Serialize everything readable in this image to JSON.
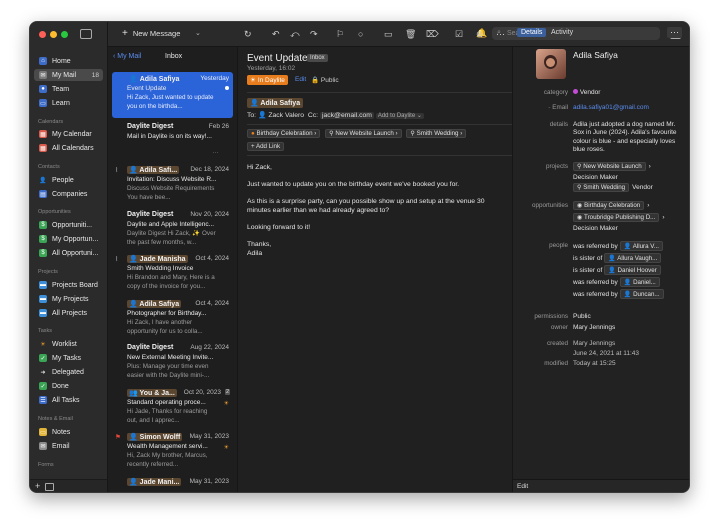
{
  "toolbar": {
    "new_message": "New Message",
    "search_placeholder": "Search"
  },
  "sidebar": {
    "items_top": [
      {
        "label": "Home"
      },
      {
        "label": "My Mail",
        "count": "18"
      },
      {
        "label": "Team"
      },
      {
        "label": "Learn"
      }
    ],
    "calendars_header": "Calendars",
    "calendars": [
      {
        "label": "My Calendar"
      },
      {
        "label": "All Calendars"
      }
    ],
    "contacts_header": "Contacts",
    "contacts": [
      {
        "label": "People"
      },
      {
        "label": "Companies"
      }
    ],
    "opportunities_header": "Opportunities",
    "opportunities": [
      {
        "label": "Opportuniti..."
      },
      {
        "label": "My Opportun..."
      },
      {
        "label": "All Opportuni..."
      }
    ],
    "projects_header": "Projects",
    "projects": [
      {
        "label": "Projects Board"
      },
      {
        "label": "My Projects"
      },
      {
        "label": "All Projects"
      }
    ],
    "tasks_header": "Tasks",
    "tasks": [
      {
        "label": "Worklist"
      },
      {
        "label": "My Tasks"
      },
      {
        "label": "Delegated"
      },
      {
        "label": "Done"
      },
      {
        "label": "All Tasks"
      }
    ],
    "notes_header": "Notes & Email",
    "notes": [
      {
        "label": "Notes"
      },
      {
        "label": "Email"
      }
    ],
    "forms_header": "Forms",
    "footer_add": "+"
  },
  "list": {
    "back": "My Mail",
    "title": "Inbox",
    "messages": [
      {
        "from": "Adila Safiya",
        "date": "Yesterday",
        "subject": "Event Update",
        "preview": "Hi Zack, Just wanted to update you on the birthda..."
      },
      {
        "from": "Daylite Digest",
        "date": "Feb 26",
        "subject": "Mail in Daylite is on its way!...",
        "preview": ""
      },
      {
        "from": "Adila Safi...",
        "date": "Dec 18, 2024",
        "subject": "Invitation: Discuss Website R...",
        "preview": "Discuss Website Requirements You have bee..."
      },
      {
        "from": "Daylite Digest",
        "date": "Nov 20, 2024",
        "subject": "Daylite and Apple Intelligenc...",
        "preview": "Daylite Digest Hi Zack, ✨ Over the past few months, w..."
      },
      {
        "from": "Jade Manisha",
        "date": "Oct 4, 2024",
        "subject": "Smith Wedding Invoice",
        "preview": "Hi Brandon and Mary, Here is a copy of the invoice for you..."
      },
      {
        "from": "Adila Safiya",
        "date": "Oct 4, 2024",
        "subject": "Photographer for Birthday...",
        "preview": "Hi Zack, I have another opportunity for us to colla..."
      },
      {
        "from": "Daylite Digest",
        "date": "Aug 22, 2024",
        "subject": "New External Meeting Invite...",
        "preview": "Plus: Manage your time even easier with the Daylite mini-..."
      },
      {
        "from": "You & Ja...",
        "date": "Oct 20, 2023",
        "count": "2",
        "subject": "Standard operating proce...",
        "preview": "Hi Jade, Thanks for reaching out, and I apprec..."
      },
      {
        "from": "Simon Wolff",
        "date": "May 31, 2023",
        "subject": "Wealth Management servi...",
        "preview": "Hi, Zack My brother, Marcus, recently referred..."
      },
      {
        "from": "Jade Mani...",
        "date": "May 31, 2023",
        "subject": "",
        "preview": ""
      }
    ]
  },
  "reader": {
    "subject": "Event Update",
    "folder_tag": "Inbox",
    "datetime": "Yesterday, 16:02",
    "in_daylite": "In Daylite",
    "edit": "Edit",
    "public": "Public",
    "sender": "Adila Safiya",
    "to_label": "To:",
    "to": "Zack Valero",
    "cc_label": "Cc:",
    "cc": "jack@email.com",
    "add_to_daylite": "Add to Daylite",
    "links": [
      "Birthday Celebration",
      "New Website Launch",
      "Smith Wedding"
    ],
    "add_link": "+ Add Link",
    "body": [
      "Hi Zack,",
      "Just wanted to update you on the birthday event we've booked you for.",
      "As this is a surprise party, can you possible show up and setup at the venue 30 minutes earlier than we had already agreed to?",
      "Looking forward to it!",
      "Thanks,",
      "Adila"
    ]
  },
  "details": {
    "tabs": [
      "Details",
      "Activity"
    ],
    "name": "Adila Safiya",
    "category_label": "category",
    "category": "Vendor",
    "category_color": "#c44bd6",
    "email_label": "Email",
    "email": "adila.safiya01@gmail.com",
    "details_label": "details",
    "details_text": "Adila just adopted a dog named Mr. Sox in June (2024). Adila's favourite colour is blue - and especially loves blue roses.",
    "projects_label": "projects",
    "projects": [
      {
        "name": "New Website Launch",
        "role": "Decision Maker"
      },
      {
        "name": "Smith Wedding",
        "role": "Vendor"
      }
    ],
    "opportunities_label": "opportunities",
    "opportunities": [
      {
        "name": "Birthday Celebration",
        "role": ""
      },
      {
        "name": "Troubridge Publishing D...",
        "role": "Decision Maker"
      }
    ],
    "people_label": "people",
    "people": [
      {
        "relation": "was referred by",
        "name": "Allura V..."
      },
      {
        "relation": "is sister of",
        "name": "Allura Vaugh..."
      },
      {
        "relation": "is sister of",
        "name": "Daniel Hoover"
      },
      {
        "relation": "was referred by",
        "name": "Daniel..."
      },
      {
        "relation": "was referred by",
        "name": "Duncan..."
      }
    ],
    "permissions_label": "permissions",
    "permissions": "Public",
    "owner_label": "owner",
    "owner": "Mary Jennings",
    "created_label": "created",
    "created_by": "Mary Jennings",
    "created_date": "June 24, 2021 at 11:43",
    "modified_label": "modified",
    "modified": "Today at 15:25",
    "footer_edit": "Edit"
  }
}
